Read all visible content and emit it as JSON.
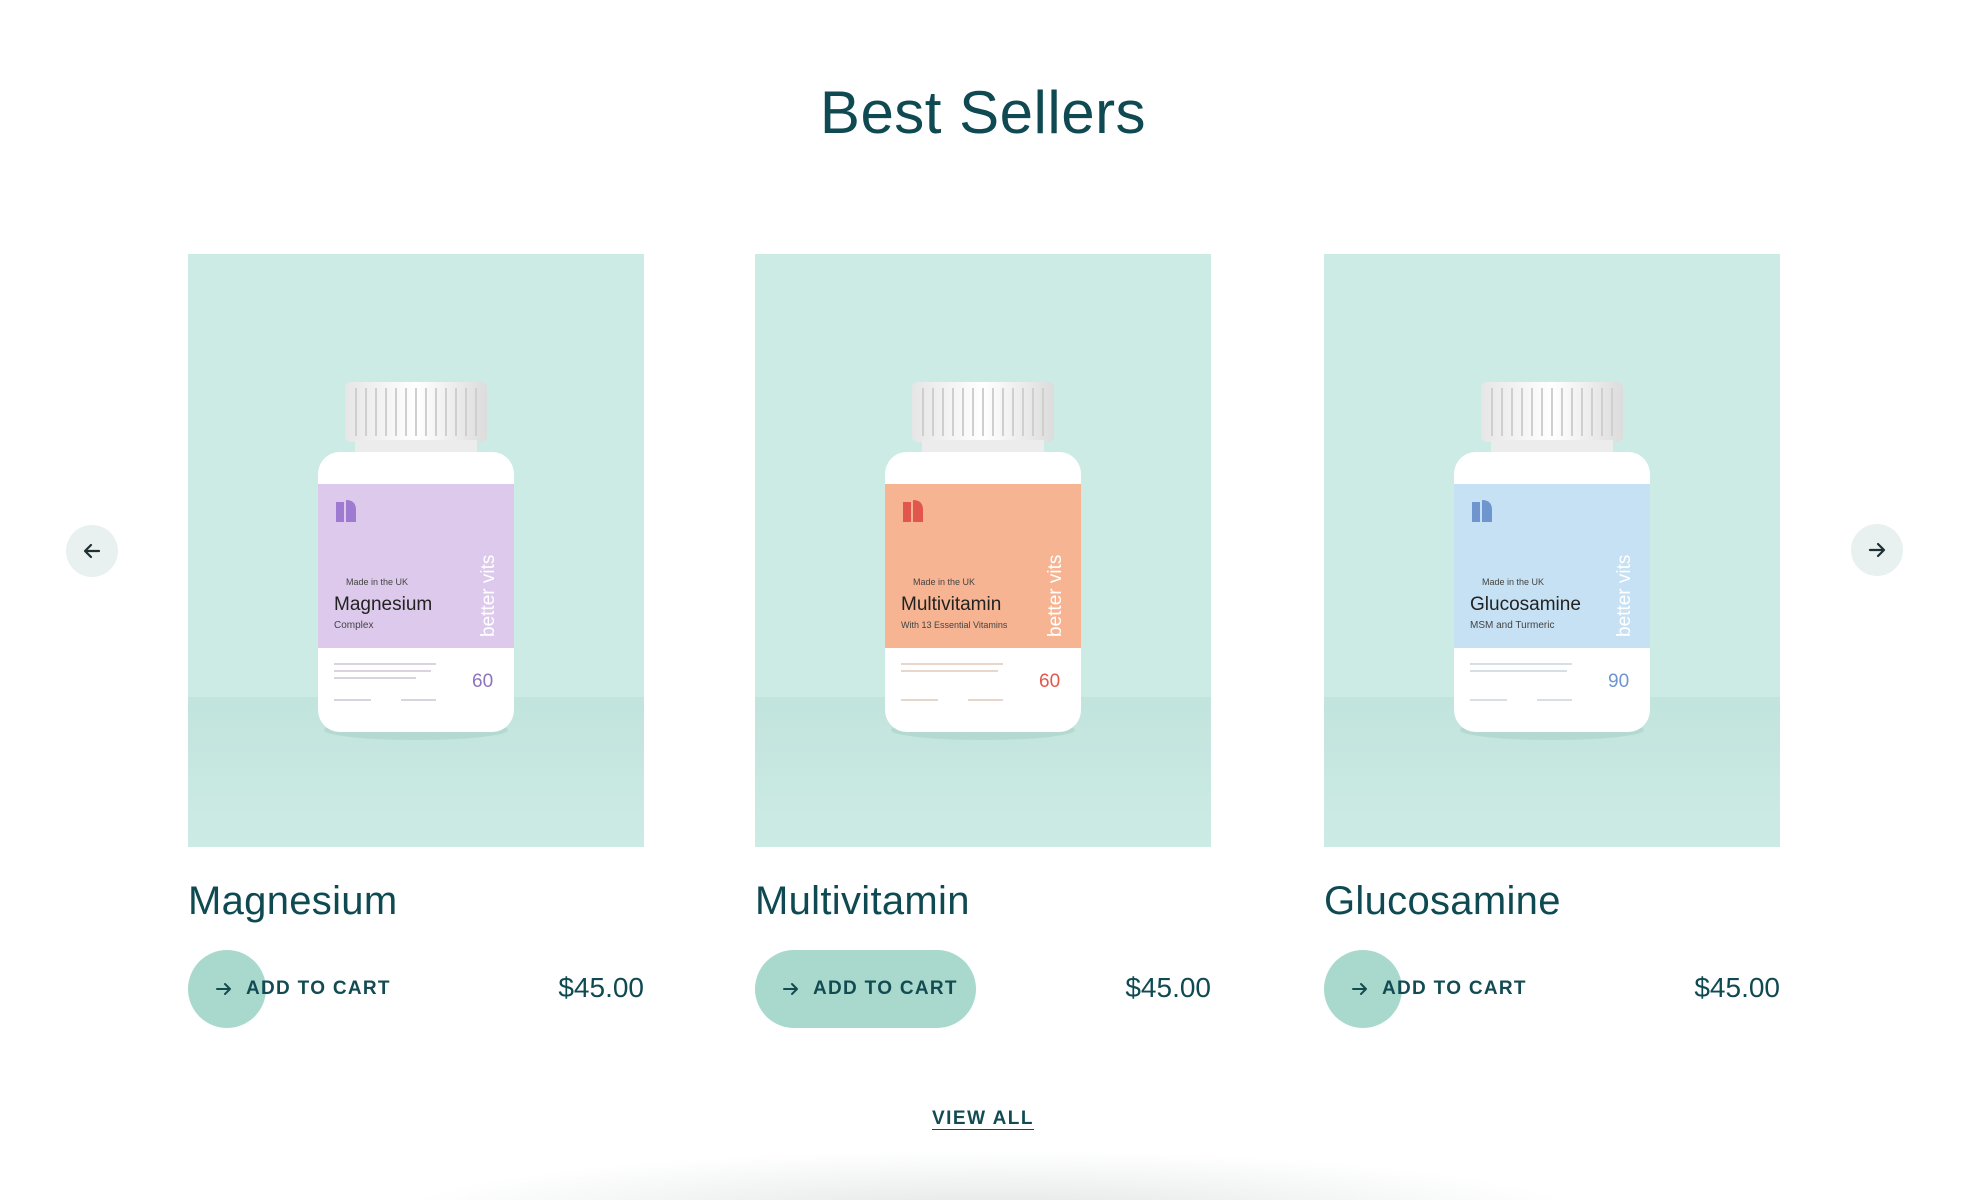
{
  "section": {
    "title": "Best Sellers"
  },
  "nav": {
    "prev_icon": "arrow-left-icon",
    "next_icon": "arrow-right-icon"
  },
  "colors": {
    "text_primary": "#0f4a52",
    "card_background": "#cdebe5",
    "button_accent": "#a9d8cc",
    "magnesium_label": "#dcc9eb",
    "multivitamin_label": "#f6b493",
    "glucosamine_label": "#c6e1f3"
  },
  "products": [
    {
      "name": "Magnesium",
      "price": "$45.00",
      "add_label": "ADD TO CART",
      "bottle": {
        "brand": "better vits",
        "origin": "Made in the UK",
        "title": "Magnesium",
        "subtitle": "Complex",
        "count": "60"
      }
    },
    {
      "name": "Multivitamin",
      "price": "$45.00",
      "add_label": "ADD TO CART",
      "bottle": {
        "brand": "better vits",
        "origin": "Made in the UK",
        "title": "Multivitamin",
        "subtitle": "With 13 Essential Vitamins",
        "count": "60"
      }
    },
    {
      "name": "Glucosamine",
      "price": "$45.00",
      "add_label": "ADD TO CART",
      "bottle": {
        "brand": "better vits",
        "origin": "Made in the UK",
        "title": "Glucosamine",
        "subtitle": "MSM and Turmeric",
        "count": "90"
      }
    }
  ],
  "footer": {
    "view_all_label": "VIEW ALL"
  }
}
